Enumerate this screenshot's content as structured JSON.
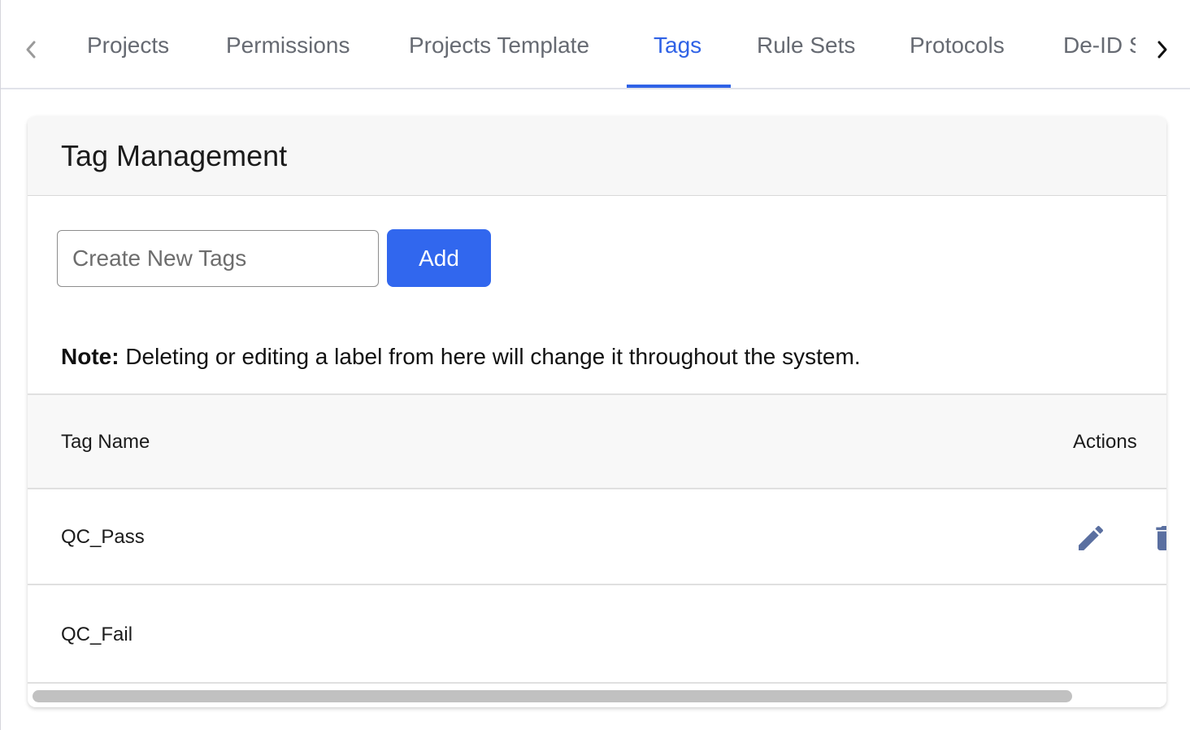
{
  "tabs": {
    "items": [
      {
        "label": "Projects",
        "active": false
      },
      {
        "label": "Permissions",
        "active": false
      },
      {
        "label": "Projects Template",
        "active": false
      },
      {
        "label": "Tags",
        "active": true
      },
      {
        "label": "Rule Sets",
        "active": false
      },
      {
        "label": "Protocols",
        "active": false
      },
      {
        "label": "De-ID S",
        "active": false
      }
    ],
    "prev_icon": "chevron-left-icon",
    "next_icon": "chevron-right-icon",
    "accent_color": "#2f62e6"
  },
  "card": {
    "title": "Tag Management",
    "input": {
      "placeholder": "Create New Tags",
      "value": ""
    },
    "add_label": "Add",
    "add_color": "#3167ee",
    "note": {
      "bold": "Note:",
      "text": " Deleting or editing a label from here will change it throughout the system."
    },
    "table": {
      "columns": [
        "Tag Name",
        "Actions"
      ],
      "rows": [
        {
          "name": "QC_Pass",
          "actions": [
            "pencil-icon",
            "trash-icon"
          ]
        },
        {
          "name": "QC_Fail",
          "actions": []
        }
      ],
      "icon_color": "#5a6fa0"
    }
  }
}
